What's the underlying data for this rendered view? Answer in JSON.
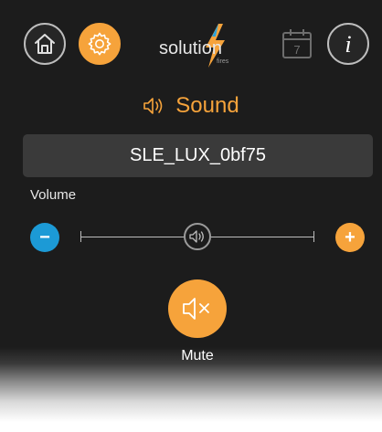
{
  "header": {
    "logo_text": "solution",
    "logo_subtext": "fires",
    "calendar_day": "7",
    "info_glyph": "i",
    "icons": [
      "home-icon",
      "gear-icon",
      "calendar-icon",
      "info-icon"
    ]
  },
  "section": {
    "title": "Sound",
    "icon": "speaker-icon"
  },
  "device": {
    "name": "SLE_LUX_0bf75"
  },
  "volume": {
    "label": "Volume",
    "decrease_glyph": "−",
    "increase_glyph": "+",
    "level": 0.5
  },
  "mute": {
    "label": "Mute",
    "icon": "speaker-mute-icon"
  },
  "colors": {
    "accent": "#f6a33b",
    "minus_button": "#1c9ad6",
    "background": "#1c1c1c",
    "panel": "#3a3a3a"
  }
}
